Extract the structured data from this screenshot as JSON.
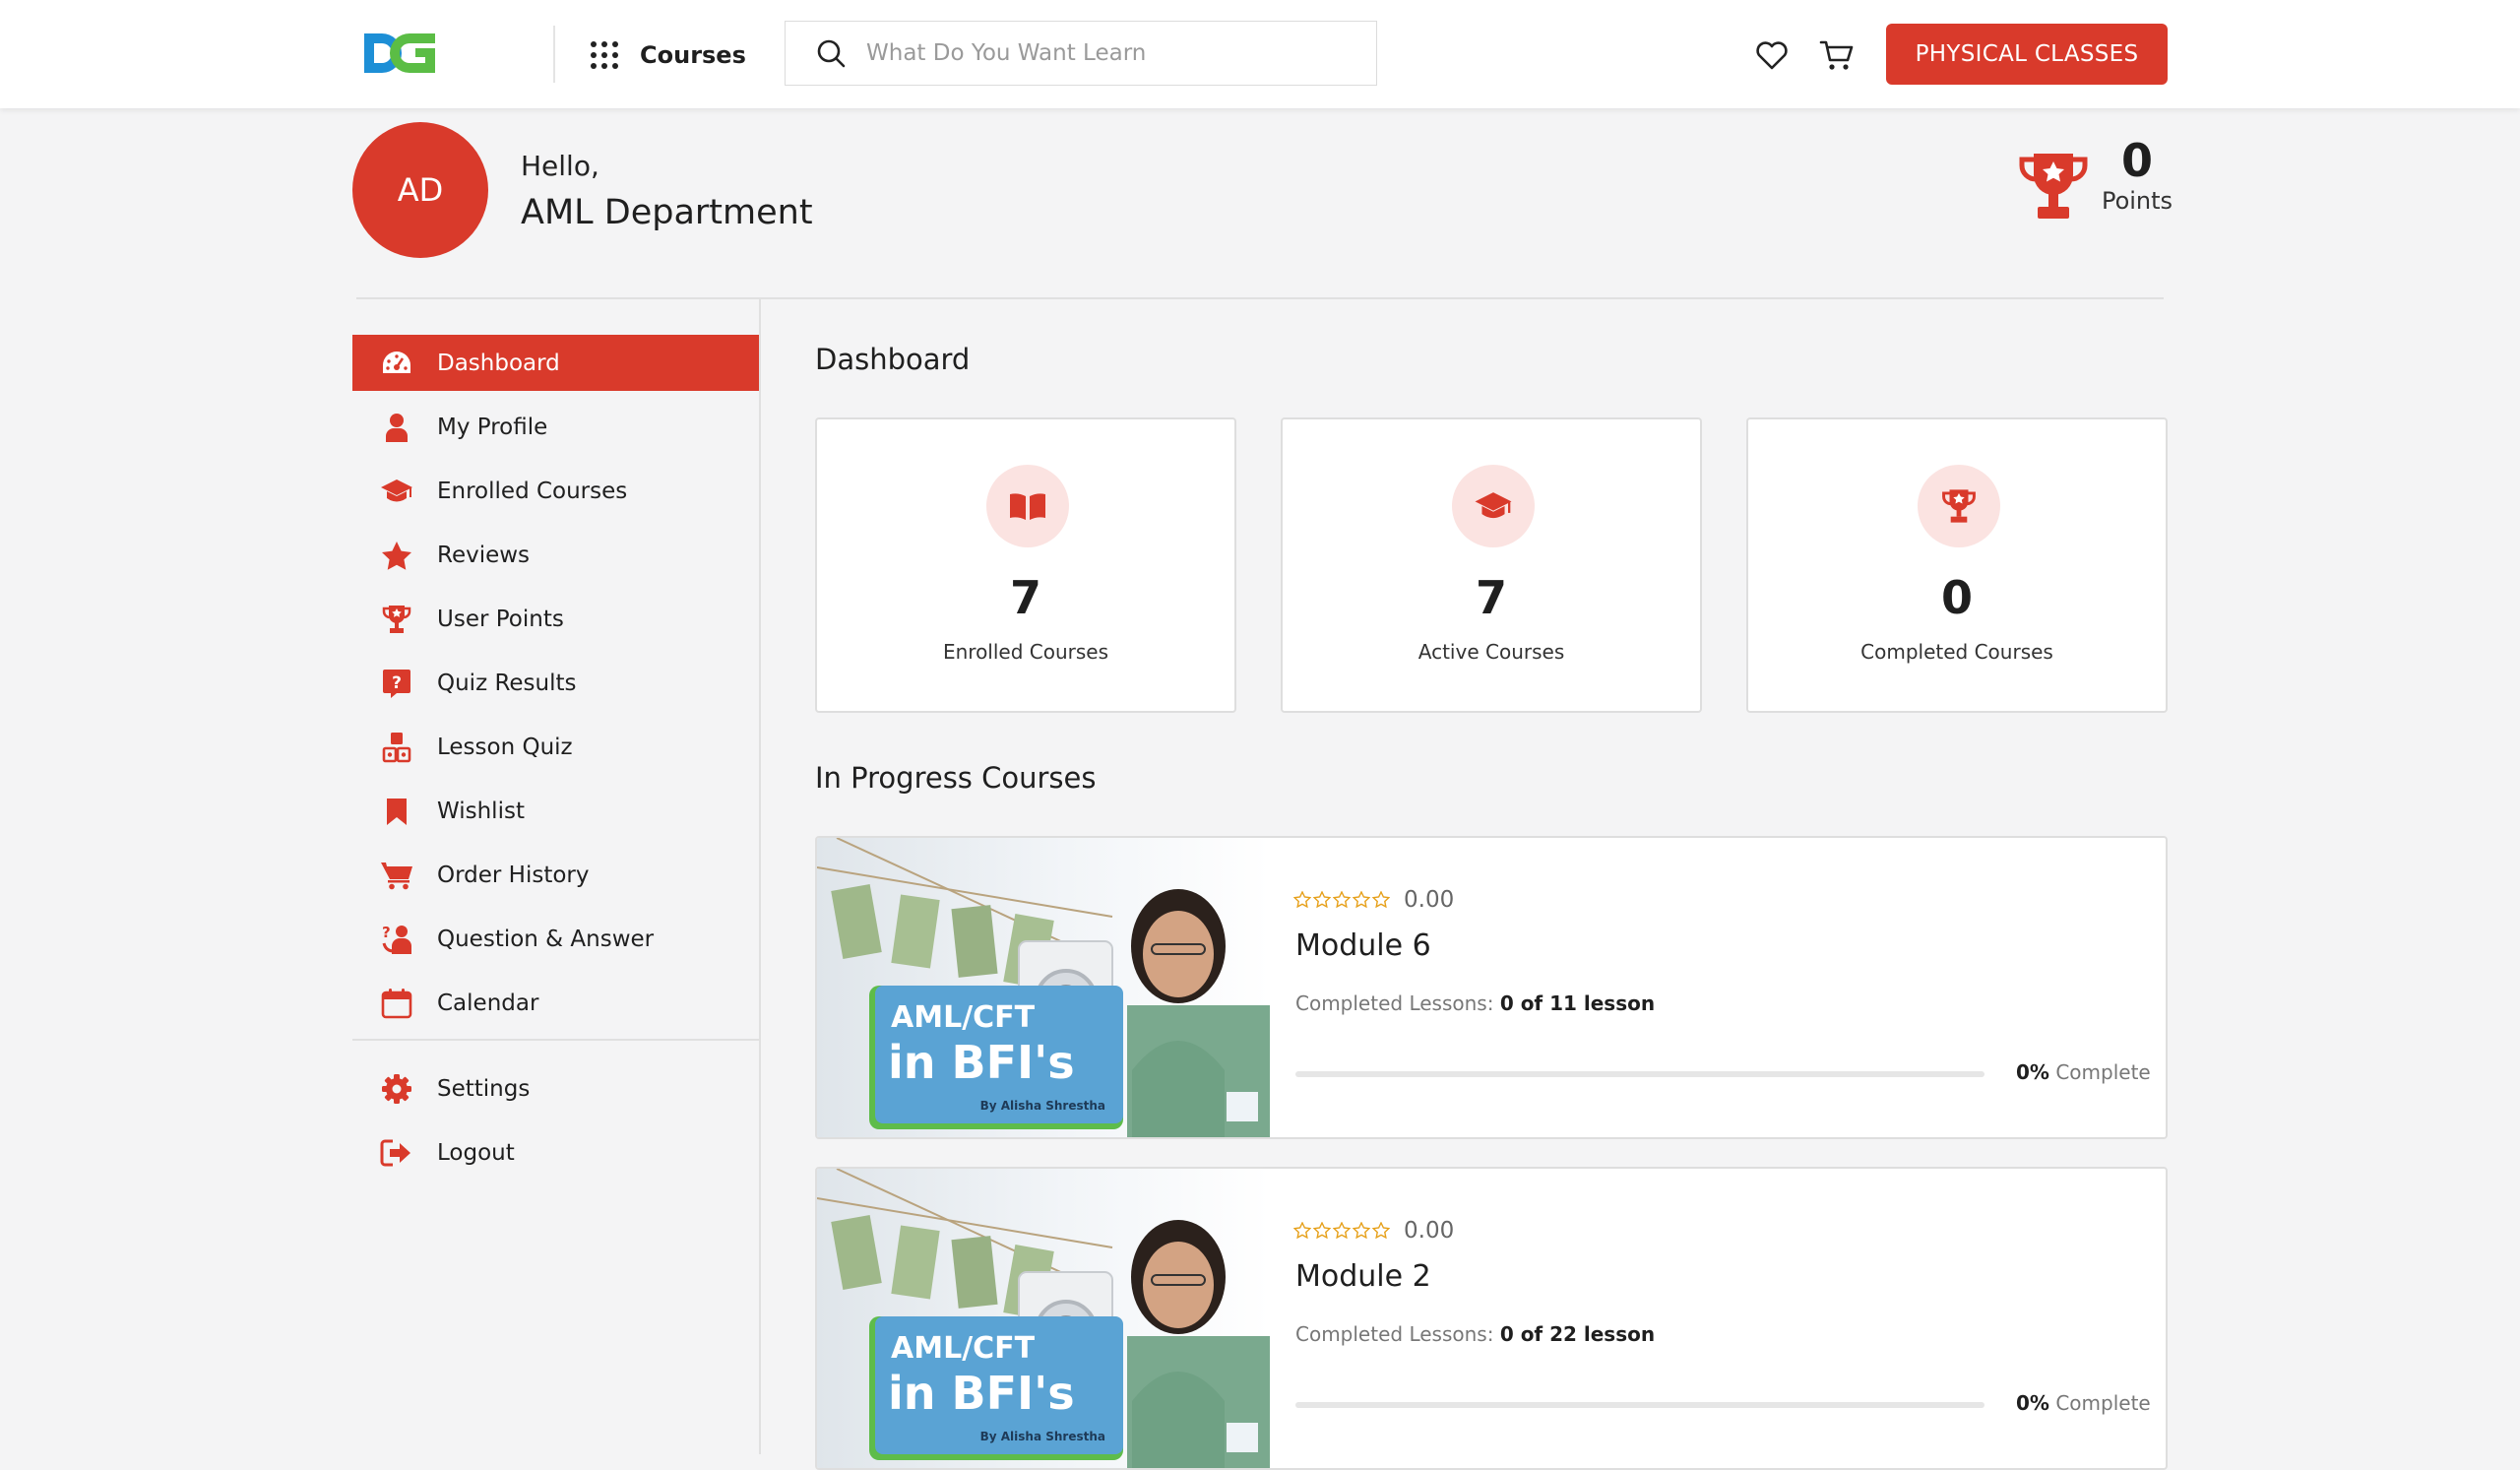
{
  "header": {
    "courses_label": "Courses",
    "search_placeholder": "What Do You Want Learn",
    "physical_classes_label": "PHYSICAL CLASSES"
  },
  "user": {
    "initials": "AD",
    "greeting": "Hello,",
    "name": "AML Department",
    "points_value": "0",
    "points_label": "Points"
  },
  "sidebar": {
    "items": [
      {
        "label": "Dashboard",
        "icon": "dashboard-icon",
        "active": true
      },
      {
        "label": "My Profile",
        "icon": "user-icon"
      },
      {
        "label": "Enrolled Courses",
        "icon": "graduation-cap-icon"
      },
      {
        "label": "Reviews",
        "icon": "star-icon"
      },
      {
        "label": "User Points",
        "icon": "trophy-icon"
      },
      {
        "label": "Quiz Results",
        "icon": "question-icon"
      },
      {
        "label": "Lesson Quiz",
        "icon": "blocks-icon"
      },
      {
        "label": "Wishlist",
        "icon": "bookmark-icon"
      },
      {
        "label": "Order History",
        "icon": "cart-icon"
      },
      {
        "label": "Question & Answer",
        "icon": "qa-icon"
      },
      {
        "label": "Calendar",
        "icon": "calendar-icon"
      }
    ],
    "bottom_items": [
      {
        "label": "Settings",
        "icon": "gear-icon"
      },
      {
        "label": "Logout",
        "icon": "logout-icon"
      }
    ]
  },
  "main": {
    "dashboard_title": "Dashboard",
    "stats": [
      {
        "value": "7",
        "label": "Enrolled Courses",
        "icon": "book-icon"
      },
      {
        "value": "7",
        "label": "Active Courses",
        "icon": "graduation-cap-icon"
      },
      {
        "value": "0",
        "label": "Completed Courses",
        "icon": "trophy-icon"
      }
    ],
    "in_progress_title": "In Progress Courses",
    "courses": [
      {
        "title": "Module 6",
        "rating": "0.00",
        "lessons_label": "Completed Lessons:",
        "lessons_value": "0 of 11 lesson",
        "progress_percent": "0%",
        "progress_label": "Complete",
        "progress_fraction": 0,
        "thumb_line1": "AML/CFT",
        "thumb_line2": "in BFI's",
        "thumb_author": "By Alisha Shrestha"
      },
      {
        "title": "Module 2",
        "rating": "0.00",
        "lessons_label": "Completed Lessons:",
        "lessons_value": "0 of 22 lesson",
        "progress_percent": "0%",
        "progress_label": "Complete",
        "progress_fraction": 0,
        "thumb_line1": "AML/CFT",
        "thumb_line2": "in BFI's",
        "thumb_author": "By Alisha Shrestha"
      }
    ]
  },
  "colors": {
    "accent": "#d93a2b",
    "accent_light": "#fbe3e1",
    "logo_blue": "#1d8fd6",
    "logo_green": "#5bbd45"
  }
}
